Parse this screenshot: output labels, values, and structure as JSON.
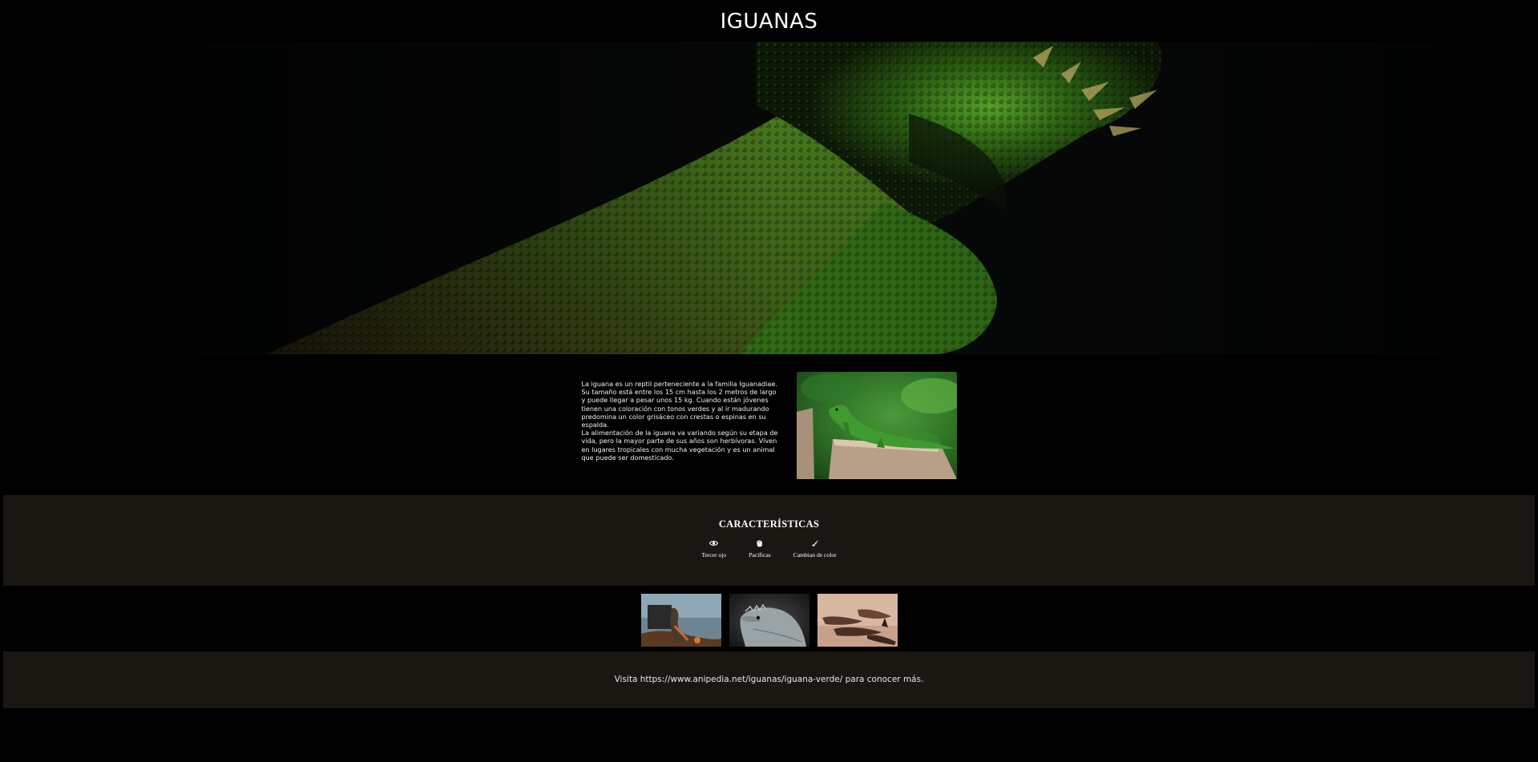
{
  "header": {
    "title": "IGUANAS"
  },
  "hero": {
    "image": "iguana-scales-closeup"
  },
  "intro": {
    "paragraph_1": "La iguana es un reptil perteneciente a la familia Iguanadiae. Su tamaño está entre los 15 cm hasta los 2 metros de largo y puede llegar a pesar unos 15 kg. Cuando están jóvenes tienen una coloración con tonos verdes y al ir madurando predomina un color grisáceo con crestas o espinas en su espalda.",
    "paragraph_2": "La alimentación de la iguana va variando según su etapa de vida, pero la mayor parte de sus años son herbívoras. Viven en lugares tropicales con mucha vegetación y es un animal que puede ser domesticado.",
    "image": "green-iguana-on-stump"
  },
  "features": {
    "title": "CARACTERÍSTICAS",
    "items": [
      {
        "icon": "eye-icon",
        "label": "Tercer ojo"
      },
      {
        "icon": "hand-icon",
        "label": "Pacíficas"
      },
      {
        "icon": "brush-icon",
        "label": "Cambian de color"
      }
    ]
  },
  "gallery": {
    "images": [
      "iguana-on-rocks",
      "iguana-head-portrait",
      "iguanas-group-sand"
    ]
  },
  "footer": {
    "text": "Visita https://www.anipedia.net/iguanas/iguana-verde/ para conocer más."
  },
  "colors": {
    "background": "#000000",
    "panel": "#1a1713",
    "text": "#ffffff"
  }
}
